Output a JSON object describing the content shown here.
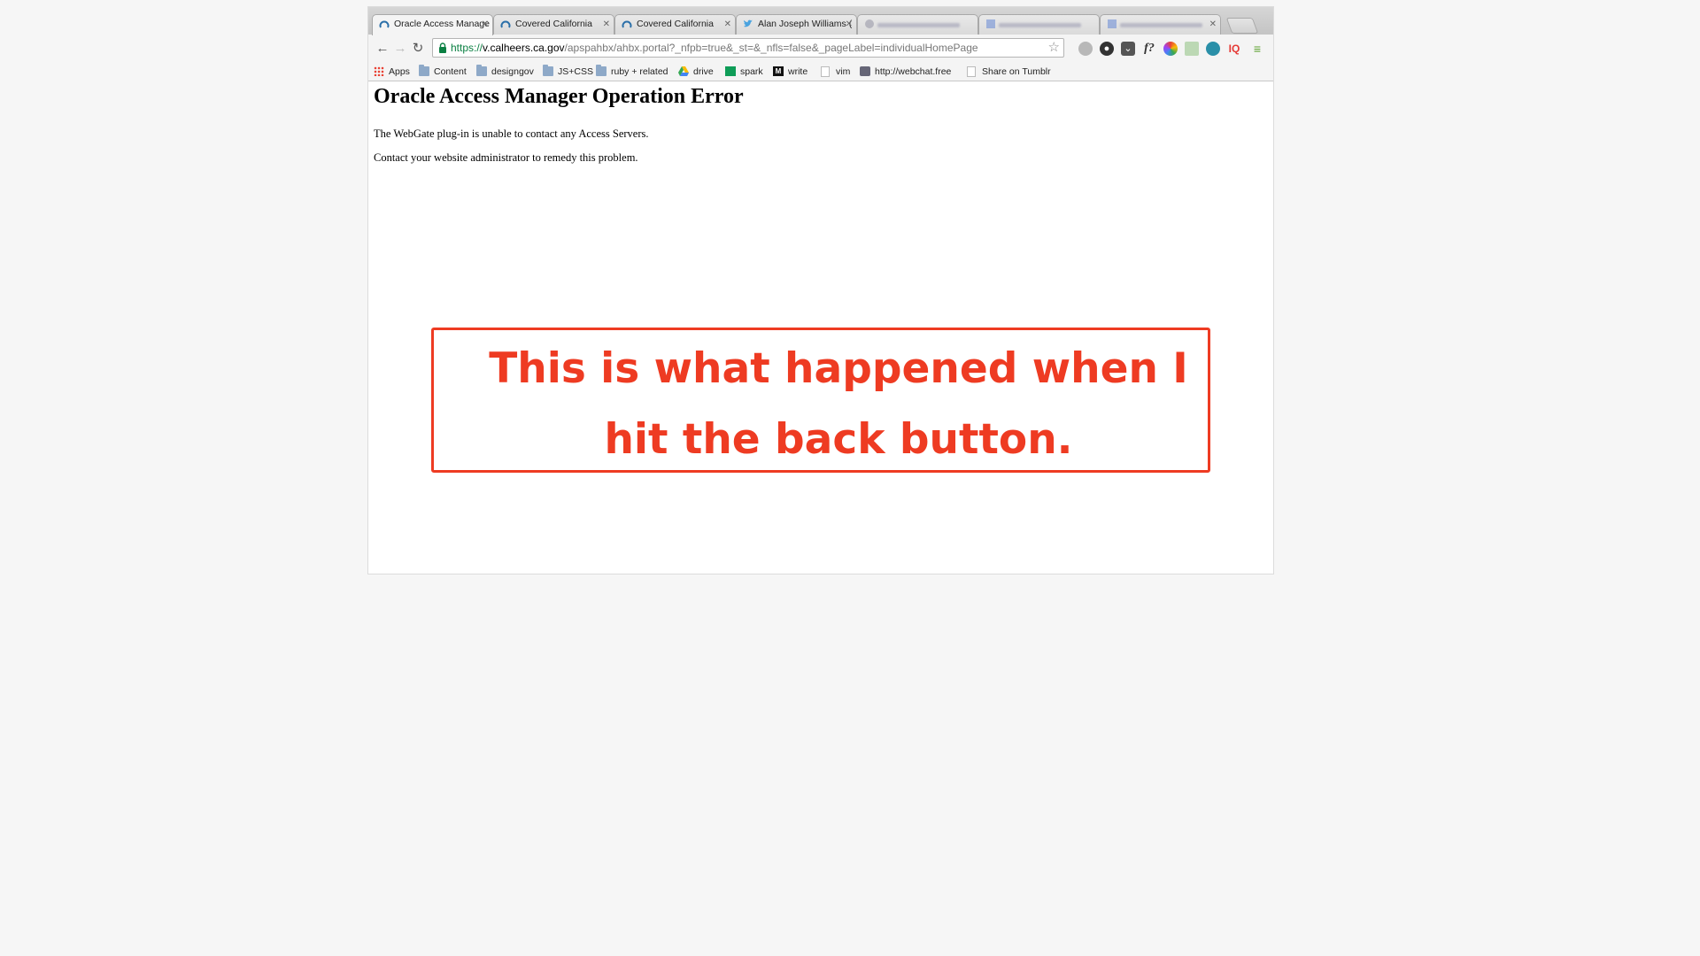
{
  "tabs": [
    {
      "label": "Oracle Access Manage",
      "icon": "calheers-favicon-icon",
      "active": true
    },
    {
      "label": "Covered California",
      "icon": "calheers-favicon-icon"
    },
    {
      "label": "Covered California",
      "icon": "calheers-favicon-icon"
    },
    {
      "label": "Alan Joseph Williams (",
      "icon": "twitter-bird-icon"
    },
    {
      "label": "",
      "icon": "blurred-favicon-icon"
    },
    {
      "label": "",
      "icon": "blurred-favicon-icon"
    },
    {
      "label": "",
      "icon": "blurred-favicon-icon"
    }
  ],
  "omnibox": {
    "scheme": "https://",
    "host": "v.calheers.ca.gov",
    "path": "/apspahbx/ahbx.portal?_nfpb=true&_st=&_nfls=false&_pageLabel=individualHomePage"
  },
  "bookmarks": [
    {
      "label": "Apps",
      "icon": "apps-grid-icon"
    },
    {
      "label": "Content",
      "icon": "folder-icon"
    },
    {
      "label": "designgov",
      "icon": "folder-icon"
    },
    {
      "label": "JS+CSS",
      "icon": "folder-icon"
    },
    {
      "label": "ruby + related",
      "icon": "folder-icon"
    },
    {
      "label": "drive",
      "icon": "google-drive-icon"
    },
    {
      "label": "spark",
      "icon": "spreadsheet-icon"
    },
    {
      "label": "write",
      "icon": "medium-m-icon"
    },
    {
      "label": "vim",
      "icon": "page-icon"
    },
    {
      "label": "http://webchat.free",
      "icon": "webchat-icon"
    },
    {
      "label": "Share on Tumblr",
      "icon": "page-icon"
    }
  ],
  "page": {
    "title": "Oracle Access Manager Operation Error",
    "line1": "The WebGate plug-in is unable to contact any Access Servers.",
    "line2": "Contact your website administrator to remedy this problem."
  },
  "annotation": {
    "text": "This is what happened when I hit the back button.",
    "color": "#ee3b22"
  },
  "colors": {
    "secure_green": "#0b8043",
    "annotation_red": "#ee3b22"
  }
}
